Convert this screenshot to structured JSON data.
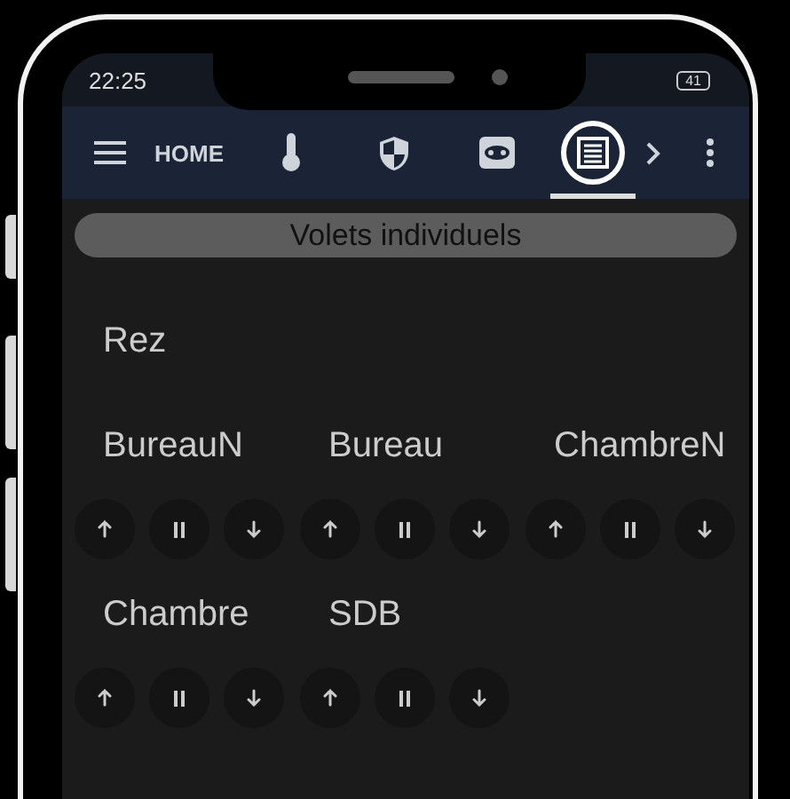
{
  "status_bar": {
    "time": "22:25",
    "battery": "41"
  },
  "tabs": [
    {
      "label": "HOME",
      "selected": false
    },
    {
      "selected": false
    },
    {
      "selected": false
    },
    {
      "selected": false
    },
    {
      "selected": true
    }
  ],
  "banner": "Volets individuels",
  "floor": "Rez",
  "shutters": [
    {
      "name": "BureauN"
    },
    {
      "name": "Bureau"
    },
    {
      "name": "ChambreN"
    },
    {
      "name": "Chambre"
    },
    {
      "name": "SDB"
    }
  ]
}
